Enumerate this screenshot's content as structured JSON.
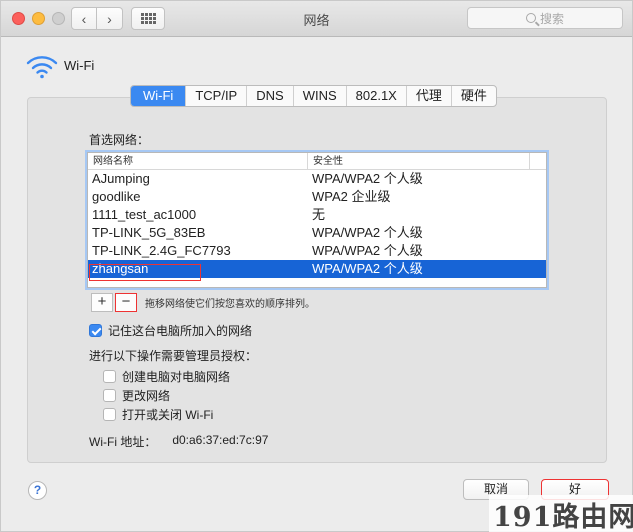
{
  "window": {
    "title": "网络",
    "search_placeholder": "搜索"
  },
  "header": {
    "label": "Wi-Fi",
    "icon": "wifi-icon"
  },
  "tabs": [
    {
      "label": "Wi-Fi",
      "active": true
    },
    {
      "label": "TCP/IP",
      "active": false
    },
    {
      "label": "DNS",
      "active": false
    },
    {
      "label": "WINS",
      "active": false
    },
    {
      "label": "802.1X",
      "active": false
    },
    {
      "label": "代理",
      "active": false
    },
    {
      "label": "硬件",
      "active": false
    }
  ],
  "preferred_networks": {
    "label": "首选网络：",
    "columns": [
      "网络名称",
      "安全性"
    ],
    "rows": [
      {
        "name": "AJumping",
        "security": "WPA/WPA2 个人级"
      },
      {
        "name": "goodlike",
        "security": "WPA2 企业级"
      },
      {
        "name": "1111_test_ac1000",
        "security": "无"
      },
      {
        "name": "TP-LINK_5G_83EB",
        "security": "WPA/WPA2 个人级"
      },
      {
        "name": "TP-LINK_2.4G_FC7793",
        "security": "WPA/WPA2 个人级"
      },
      {
        "name": "zhangsan",
        "security": "WPA/WPA2 个人级",
        "selected": true
      }
    ],
    "add_label": "+",
    "remove_label": "−",
    "hint": "拖移网络使它们按您喜欢的顺序排列。"
  },
  "options": {
    "remember_label": "记住这台电脑所加入的网络",
    "remember_checked": true,
    "admin_label": "进行以下操作需要管理员授权：",
    "admin_items": [
      {
        "label": "创建电脑对电脑网络",
        "checked": false
      },
      {
        "label": "更改网络",
        "checked": false
      },
      {
        "label": "打开或关闭 Wi-Fi",
        "checked": false
      }
    ]
  },
  "mac": {
    "label": "Wi-Fi 地址：",
    "value": "d0:a6:37:ed:7c:97"
  },
  "footer": {
    "help_label": "?",
    "cancel_label": "取消",
    "ok_label": "好"
  },
  "watermark": "191路由网",
  "colors": {
    "accent": "#3b89f1",
    "selection": "#1764d6",
    "highlight_red": "#e33333"
  }
}
